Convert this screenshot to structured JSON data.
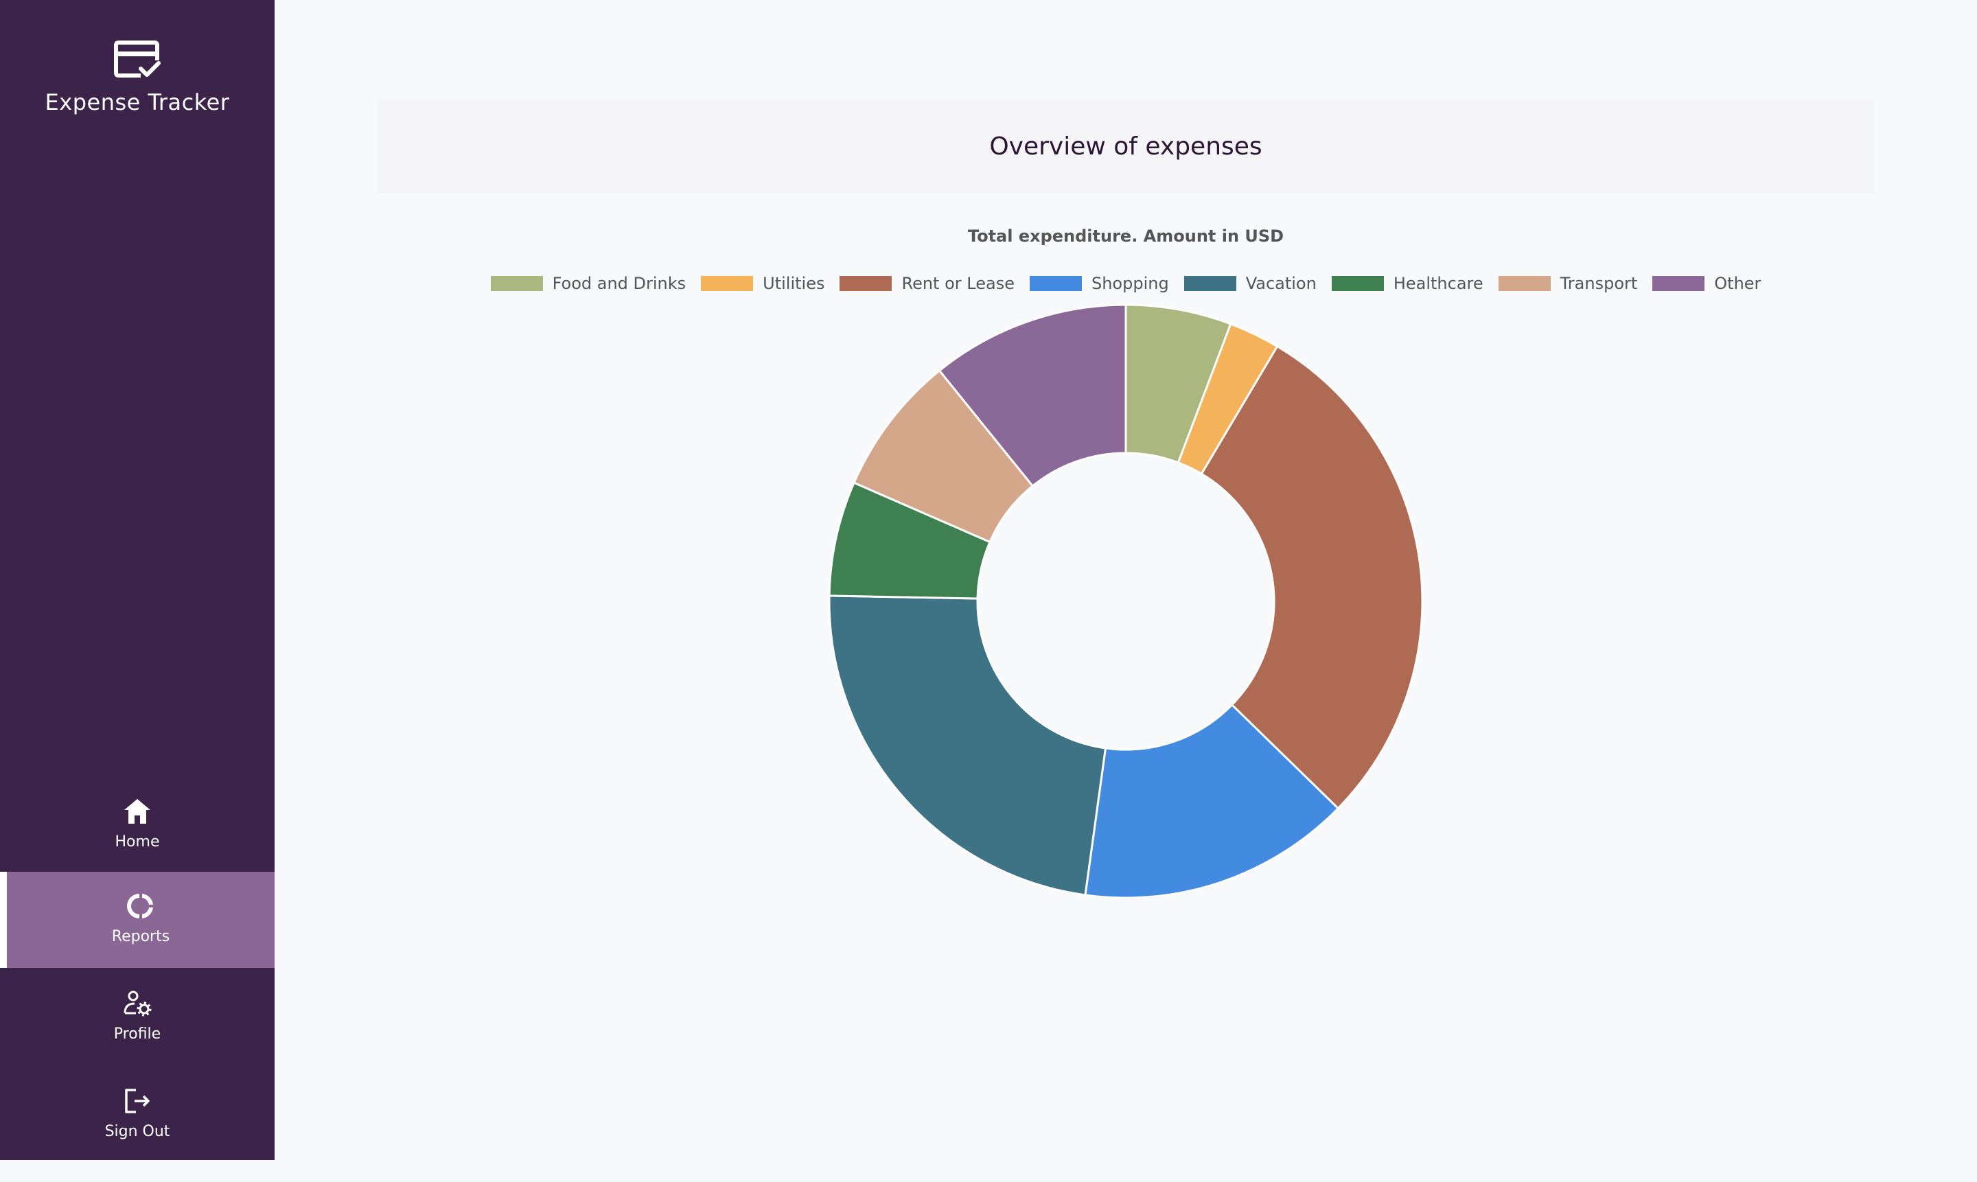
{
  "app": {
    "name": "Expense Tracker"
  },
  "sidebar": {
    "items": [
      {
        "label": "Home",
        "icon": "home-icon",
        "active": false
      },
      {
        "label": "Reports",
        "icon": "donut-chart-icon",
        "active": true
      },
      {
        "label": "Profile",
        "icon": "user-settings-icon",
        "active": false
      },
      {
        "label": "Sign Out",
        "icon": "sign-out-icon",
        "active": false
      }
    ]
  },
  "main": {
    "page_title": "Overview of expenses"
  },
  "colors": {
    "sidebar_bg": "#3c2349",
    "sidebar_active": "#8b6796",
    "page_bg": "#f8f9fa"
  },
  "chart_data": {
    "type": "doughnut",
    "title": "Total expenditure. Amount in USD",
    "legend_position": "top",
    "categories": [
      "Food and Drinks",
      "Utilities",
      "Rent or Lease",
      "Shopping",
      "Vacation",
      "Healthcare",
      "Transport",
      "Other"
    ],
    "values": [
      5.8,
      2.8,
      29.0,
      15.0,
      23.3,
      6.3,
      7.7,
      10.9
    ],
    "colors": [
      "#abb77f",
      "#f4b25a",
      "#ae6a52",
      "#428be0",
      "#3e7386",
      "#3e8050",
      "#d4a78a",
      "#8a6897"
    ]
  }
}
